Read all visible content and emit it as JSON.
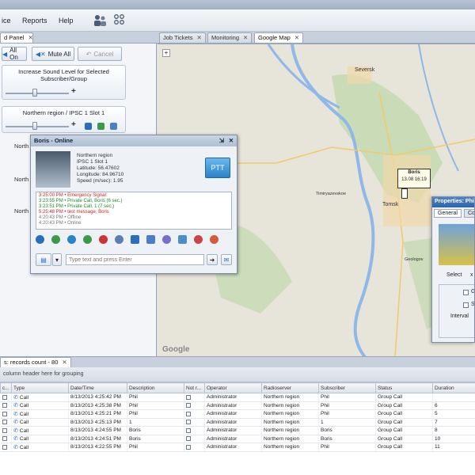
{
  "menu": {
    "items": [
      "ice",
      "Reports",
      "Help"
    ]
  },
  "tabs": {
    "left": "d Panel",
    "job_tickets": "Job Tickets",
    "monitoring": "Monitoring",
    "google_map": "Google Map",
    "close": "✕"
  },
  "control_panel": {
    "all_on": "All On",
    "mute_all": "Mute All",
    "cancel": "Cancel",
    "increase_label": "Increase Sound Level for Selected Subscriber/Group",
    "region_box_label": "Northern region / IPSC 1 Slot 1",
    "partial_labels": [
      "North",
      "North",
      "North"
    ]
  },
  "boris_dialog": {
    "title": "Boris - Online",
    "region": "Northern region",
    "slot": "IPSC 1 Slot 1",
    "latitude": "Latitude: 56.47602",
    "longitude": "Longitude: 84.96710",
    "speed": "Speed (m/sec): 1.95",
    "ptt": "PTT",
    "log": [
      {
        "text": "3:25:00 PM • Emergency Signal: ",
        "color": "#cc2222"
      },
      {
        "text": "3:23:55 PM • Private Call, Boris (6 sec.)",
        "color": "#1a8a2a"
      },
      {
        "text": "3:23:51 PM • Private Call, 1 (7 sec.)",
        "color": "#1a8a2a"
      },
      {
        "text": "5:25:48 PM • test message, Boris",
        "color": "#cc2222"
      },
      {
        "text": "4:20:43 PM • Offline",
        "color": "#777777"
      },
      {
        "text": "4:20:43 PM • Online",
        "color": "#777777"
      }
    ],
    "input_placeholder": "Type text and press Enter"
  },
  "map": {
    "labels": [
      "Seversk",
      "Tomsk",
      "Geologov",
      "Timiryazevskoe",
      "Boris"
    ],
    "marker_name": "Boris",
    "marker_time": "13.08 16:19",
    "watermark": "Google"
  },
  "properties": {
    "title": "Properties: Phil",
    "tab_general": "General",
    "tab_other": "Co",
    "select": "Select",
    "x": "x",
    "g": "G",
    "s": "Sh",
    "interval": "Interval"
  },
  "grid": {
    "tab_title": "s: records count - 80",
    "tab_close": "✕",
    "group_hint": "column header here for grouping",
    "columns": [
      "c...",
      "Type",
      "Date/Time",
      "Description",
      "Not r...",
      "Operator",
      "Radioserver",
      "Subscriber",
      "Status",
      "Duration"
    ],
    "rows": [
      {
        "type": "Call",
        "datetime": "8/13/2013 4:25:42 PM",
        "desc": "Phil",
        "operator": "Administrator",
        "server": "Northern region",
        "subscriber": "Phil",
        "status": "Group Call",
        "duration": ""
      },
      {
        "type": "Call",
        "datetime": "8/13/2013 4:25:38 PM",
        "desc": "Phil",
        "operator": "Administrator",
        "server": "Northern region",
        "subscriber": "Phil",
        "status": "Group Call",
        "duration": "6"
      },
      {
        "type": "Call",
        "datetime": "8/13/2013 4:25:21 PM",
        "desc": "Phil",
        "operator": "Administrator",
        "server": "Northern region",
        "subscriber": "Phil",
        "status": "Group Call",
        "duration": "5"
      },
      {
        "type": "Call",
        "datetime": "8/13/2013 4:25:13 PM",
        "desc": "1",
        "operator": "Administrator",
        "server": "Northern region",
        "subscriber": "1",
        "status": "Group Call",
        "duration": "7"
      },
      {
        "type": "Call",
        "datetime": "8/13/2013 4:24:55 PM",
        "desc": "Boris",
        "operator": "Administrator",
        "server": "Northern region",
        "subscriber": "Boris",
        "status": "Group Call",
        "duration": "8"
      },
      {
        "type": "Call",
        "datetime": "8/13/2013 4:24:51 PM",
        "desc": "Boris",
        "operator": "Administrator",
        "server": "Northern region",
        "subscriber": "Boris",
        "status": "Group Call",
        "duration": "10"
      },
      {
        "type": "Call",
        "datetime": "8/13/2013 4:22:55 PM",
        "desc": "Phil",
        "operator": "Administrator",
        "server": "Northern region",
        "subscriber": "Phil",
        "status": "Group Call",
        "duration": "11"
      }
    ]
  },
  "colors": {
    "accent": "#2a82c9",
    "map_bg": "#e7e4d9",
    "river": "#8fb7e8",
    "forest": "#bcd9a8"
  }
}
